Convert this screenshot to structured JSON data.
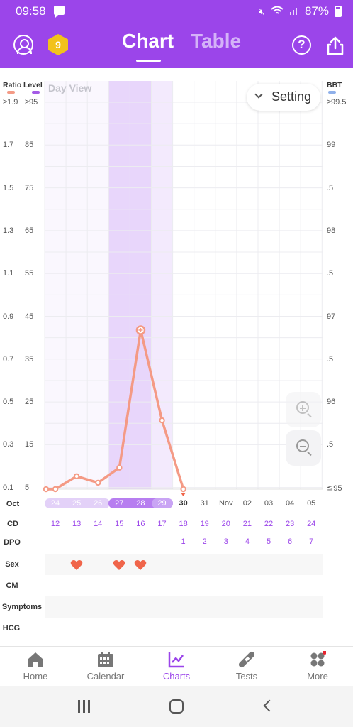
{
  "status_bar": {
    "time": "09:58",
    "battery": "87%",
    "icons": [
      "message-icon",
      "mute-icon",
      "wifi-icon",
      "signal-icon",
      "battery-icon"
    ]
  },
  "app_bar": {
    "badge_number": "9",
    "tabs": [
      {
        "label": "Chart",
        "active": true
      },
      {
        "label": "Table",
        "active": false
      }
    ],
    "help_glyph": "?"
  },
  "chart": {
    "day_view_label": "Day View",
    "setting_label": "Setting",
    "left_axis": {
      "ratio_header": "Ratio",
      "level_header": "Level",
      "ratio_ticks": [
        "≥1.9",
        "1.7",
        "1.5",
        "1.3",
        "1.1",
        "0.9",
        "0.7",
        "0.5",
        "0.3",
        "0.1"
      ],
      "level_ticks": [
        "≥95",
        "85",
        "75",
        "65",
        "55",
        "45",
        "35",
        "25",
        "15",
        "5"
      ]
    },
    "right_axis": {
      "header": "BBT",
      "ticks": [
        "≥99.5",
        "99",
        ".5",
        "98",
        ".5",
        "97",
        ".5",
        "96",
        ".5",
        "≦95"
      ]
    },
    "colors": {
      "ratio": "#f49a85",
      "level": "#a45be6",
      "bbt": "#8fb0ea",
      "fertile_window": "#f3eafd",
      "peak_window": "#e8d6fb"
    },
    "rows": {
      "month_label": "Oct",
      "cd_label": "CD",
      "dpo_label": "DPO",
      "sex_label": "Sex",
      "cm_label": "CM",
      "symptoms_label": "Symptoms",
      "hcg_label": "HCG"
    },
    "days": [
      {
        "date": "24",
        "cd": "12",
        "dpo": "",
        "sex": false
      },
      {
        "date": "25",
        "cd": "13",
        "dpo": "",
        "sex": true
      },
      {
        "date": "26",
        "cd": "14",
        "dpo": "",
        "sex": false
      },
      {
        "date": "27",
        "cd": "15",
        "dpo": "",
        "sex": true
      },
      {
        "date": "28",
        "cd": "16",
        "dpo": "",
        "sex": true
      },
      {
        "date": "29",
        "cd": "17",
        "dpo": "",
        "sex": false
      },
      {
        "date": "30",
        "cd": "18",
        "dpo": "1",
        "sex": false
      },
      {
        "date": "31",
        "cd": "19",
        "dpo": "2",
        "sex": false
      },
      {
        "date": "Nov",
        "cd": "20",
        "dpo": "3",
        "sex": false
      },
      {
        "date": "02",
        "cd": "21",
        "dpo": "4",
        "sex": false
      },
      {
        "date": "03",
        "cd": "22",
        "dpo": "5",
        "sex": false
      },
      {
        "date": "04",
        "cd": "23",
        "dpo": "6",
        "sex": false
      },
      {
        "date": "05",
        "cd": "24",
        "dpo": "7",
        "sex": false
      }
    ]
  },
  "chart_data": {
    "type": "line",
    "x": [
      "Oct 23",
      "Oct 24",
      "Oct 25",
      "Oct 26",
      "Oct 27",
      "Oct 28",
      "Oct 29",
      "Oct 30"
    ],
    "series": [
      {
        "name": "Level",
        "values": [
          5,
          5,
          8,
          6.5,
          10,
          42,
          21,
          5
        ]
      }
    ],
    "ylim": [
      5,
      95
    ],
    "peak_day": "Oct 28",
    "grid": true
  },
  "bottom_nav": [
    {
      "label": "Home",
      "icon": "home-icon",
      "active": false
    },
    {
      "label": "Calendar",
      "icon": "calendar-icon",
      "active": false
    },
    {
      "label": "Charts",
      "icon": "chart-icon",
      "active": true
    },
    {
      "label": "Tests",
      "icon": "test-strip-icon",
      "active": false
    },
    {
      "label": "More",
      "icon": "more-icon",
      "active": false,
      "has_dot": true
    }
  ]
}
